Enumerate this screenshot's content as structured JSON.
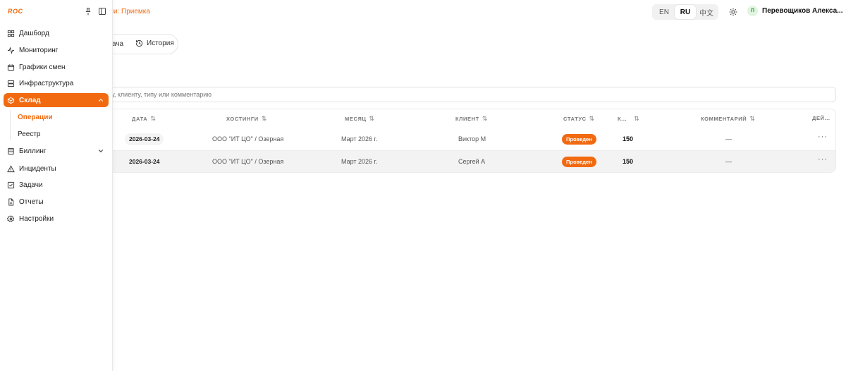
{
  "sidebar": {
    "logo_text": "ROC",
    "items": [
      {
        "label": "Дашборд",
        "icon": "dashboard-icon"
      },
      {
        "label": "Мониторинг",
        "icon": "activity-icon"
      },
      {
        "label": "Графики смен",
        "icon": "calendar-icon"
      },
      {
        "label": "Инфраструктура",
        "icon": "server-icon"
      },
      {
        "label": "Склад",
        "icon": "box-icon"
      },
      {
        "label": "Биллинг",
        "icon": "billing-icon"
      },
      {
        "label": "Инциденты",
        "icon": "warning-icon"
      },
      {
        "label": "Задачи",
        "icon": "checkbox-icon"
      },
      {
        "label": "Отчеты",
        "icon": "file-icon"
      },
      {
        "label": "Настройки",
        "icon": "gear-icon"
      }
    ],
    "sub_items": [
      {
        "label": "Операции"
      },
      {
        "label": "Реестр"
      }
    ]
  },
  "header": {
    "breadcrumb": "ации: Приемка",
    "languages": [
      "EN",
      "RU",
      "中文"
    ],
    "active_language": "RU",
    "user_initial": "П",
    "user_name": "Перевощиков Алекса..."
  },
  "tabs": [
    {
      "label": "ача"
    },
    {
      "label": "История"
    }
  ],
  "search": {
    "placeholder": "ингу, клиенту, типу или комментарию"
  },
  "table": {
    "columns": [
      "ДАТА",
      "ХОСТИНГИ",
      "МЕСЯЦ",
      "КЛИЕНТ",
      "СТАТУС",
      "К...",
      "КОММЕНТАРИЙ",
      "ДЕЙ..."
    ],
    "rows": [
      {
        "date": "2026-03-24",
        "hosting": "ООО \"ИТ ЦО\" / Озерная",
        "month": "Март 2026 г.",
        "client": "Виктор М",
        "status": "Проведен",
        "qty": "150",
        "comment": "—",
        "actions": "···"
      },
      {
        "date": "2026-03-24",
        "hosting": "ООО \"ИТ ЦО\" / Озерная",
        "month": "Март 2026 г.",
        "client": "Сергей А",
        "status": "Проведен",
        "qty": "150",
        "comment": "—",
        "actions": "···"
      }
    ],
    "sort_glyph": "⇅"
  },
  "colors": {
    "accent": "#f26a10",
    "avatar_bg": "#dff5df"
  }
}
